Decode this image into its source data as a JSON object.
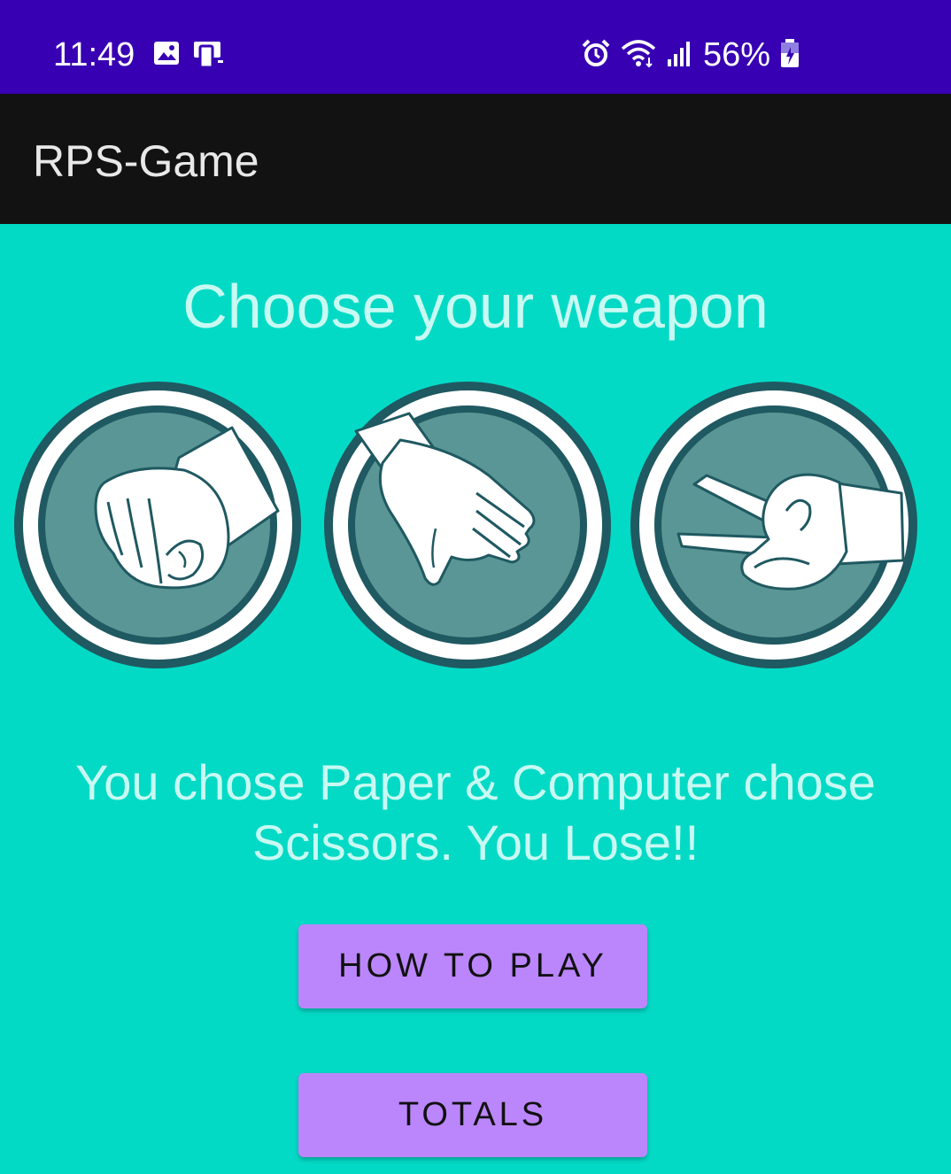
{
  "status_bar": {
    "time": "11:49",
    "battery": "56%",
    "icons_left": [
      "gallery-icon",
      "screen-mirror-icon"
    ],
    "icons_right": [
      "alarm-icon",
      "wifi-icon",
      "signal-icon",
      "battery-charging-icon"
    ]
  },
  "app_bar": {
    "title": "RPS-Game"
  },
  "main": {
    "headline": "Choose your weapon",
    "weapons": [
      {
        "name": "rock",
        "icon": "rock-fist-icon"
      },
      {
        "name": "paper",
        "icon": "paper-hand-icon"
      },
      {
        "name": "scissors",
        "icon": "scissors-hand-icon"
      }
    ],
    "result_text": "You chose Paper & Computer chose Scissors. You Lose!!",
    "buttons": {
      "how_to_play": "HOW TO PLAY",
      "totals": "TOTALS"
    }
  },
  "colors": {
    "status_bar": "#3700B3",
    "app_bar": "#121212",
    "background": "#03DAC6",
    "button": "#BB86FC",
    "circle_fill": "#5B9696",
    "circle_ring": "#1F5961"
  }
}
